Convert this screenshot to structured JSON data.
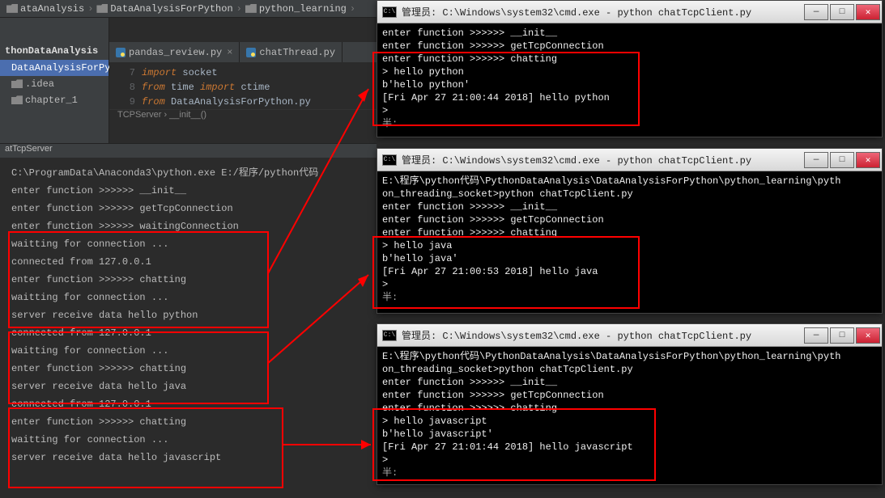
{
  "ide": {
    "crumbs": [
      "ataAnalysis",
      "DataAnalysisForPython",
      "python_learning"
    ],
    "project_title": "thonDataAnalysis",
    "tree": [
      "DataAnalysisForPyth",
      ".idea",
      "chapter_1"
    ],
    "tabs": [
      "pandas_review.py",
      "chatThread.py"
    ],
    "lines": {
      "n": [
        "7",
        "8",
        "9"
      ]
    },
    "code": {
      "l1_kw": "import",
      "l1_nm": " socket",
      "l2_kw1": "from",
      "l2_nm1": " time ",
      "l2_kw2": "import",
      "l2_nm2": " ctime",
      "l3_kw1": "from",
      "l3_nm1": " DataAnalysisForPython.py"
    },
    "bc2": "TCPServer  ›  __init__()",
    "tool_title": "atTcpServer"
  },
  "console": [
    "C:\\ProgramData\\Anaconda3\\python.exe E:/程序/python代码",
    "enter function >>>>>> __init__",
    "enter function >>>>>> getTcpConnection",
    "enter function >>>>>> waitingConnection",
    "waitting for connection ...",
    "connected from 127.0.0.1",
    "enter function >>>>>> chatting",
    "waitting for connection ...",
    "server receive data hello python",
    "connected from 127.0.0.1",
    "waitting for connection ...",
    "enter function >>>>>> chatting",
    "server receive data hello java",
    "connected from 127.0.0.1",
    "enter function >>>>>> chatting",
    "waitting for connection ...",
    "server receive data hello javascript"
  ],
  "cmd_title": "管理员: C:\\Windows\\system32\\cmd.exe - python  chatTcpClient.py",
  "cmd1": [
    "enter function >>>>>> __init__",
    "enter function >>>>>> getTcpConnection",
    "enter function >>>>>> chatting",
    "> hello python",
    "b'hello python'",
    "[Fri Apr 27 21:00:44 2018] hello python",
    ">",
    "                    半:"
  ],
  "cmd2": [
    "",
    "E:\\程序\\python代码\\PythonDataAnalysis\\DataAnalysisForPython\\python_learning\\pyth",
    "on_threading_socket>python chatTcpClient.py",
    "enter function >>>>>> __init__",
    "enter function >>>>>> getTcpConnection",
    "enter function >>>>>> chatting",
    "> hello java",
    "b'hello java'",
    "[Fri Apr 27 21:00:53 2018] hello java",
    ">",
    "                    半:"
  ],
  "cmd3": [
    "",
    "E:\\程序\\python代码\\PythonDataAnalysis\\DataAnalysisForPython\\python_learning\\pyth",
    "on_threading_socket>python chatTcpClient.py",
    "enter function >>>>>> __init__",
    "enter function >>>>>> getTcpConnection",
    "enter function >>>>>> chatting",
    "> hello javascript",
    "b'hello javascript'",
    "[Fri Apr 27 21:01:44 2018] hello javascript",
    ">",
    "                    半:"
  ]
}
